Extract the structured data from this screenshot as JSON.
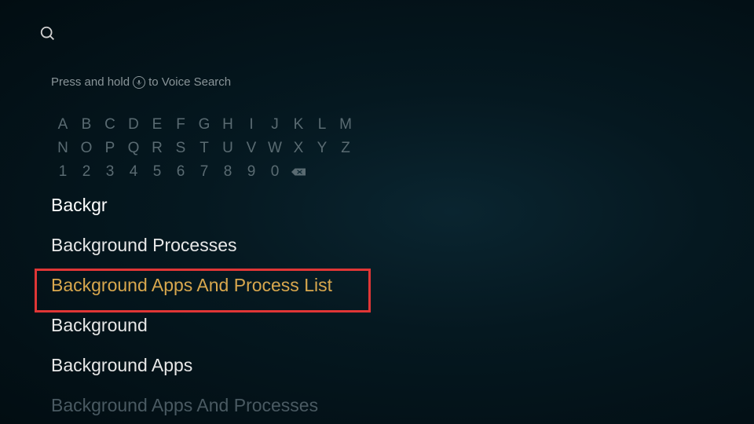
{
  "hint": {
    "prefix": "Press and hold",
    "suffix": "to Voice Search"
  },
  "keyboard": {
    "row1": [
      "A",
      "B",
      "C",
      "D",
      "E",
      "F",
      "G",
      "H",
      "I",
      "J",
      "K",
      "L",
      "M"
    ],
    "row2": [
      "N",
      "O",
      "P",
      "Q",
      "R",
      "S",
      "T",
      "U",
      "V",
      "W",
      "X",
      "Y",
      "Z"
    ],
    "row3": [
      "1",
      "2",
      "3",
      "4",
      "5",
      "6",
      "7",
      "8",
      "9",
      "0"
    ]
  },
  "query": "Backgr",
  "results": [
    {
      "label": "Background Processes",
      "highlighted": false
    },
    {
      "label": "Background Apps And Process List",
      "highlighted": true
    },
    {
      "label": "Background",
      "highlighted": false
    },
    {
      "label": "Background Apps",
      "highlighted": false
    },
    {
      "label": "Background Apps And Processes",
      "highlighted": false,
      "faded": true
    }
  ]
}
